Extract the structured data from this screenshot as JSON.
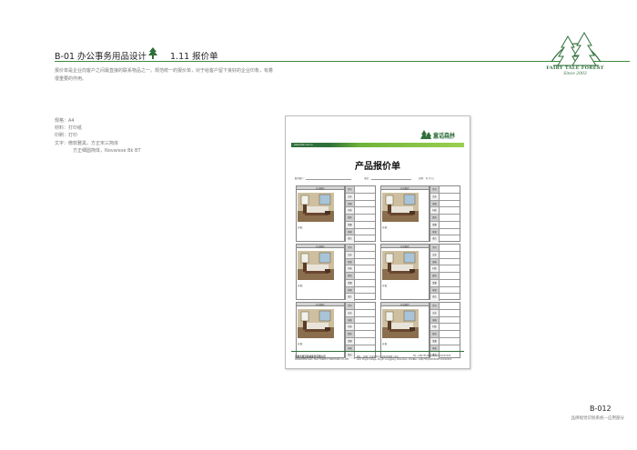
{
  "header": {
    "section_title": "B-01 办公事务用品设计",
    "item_title": "1.11  报价单",
    "intro": "报价单是企业向客户之间最直接的联系物品之一。规范统一的报价单，对于给客户留下良好的企业印象，有着很重要的作用。"
  },
  "specs": {
    "size": "规格：A4",
    "material": "材料：打印纸",
    "print": "印刷：打印",
    "text1": "文字：微软雅黑，方正宋三简体",
    "text2": "方正细圆简体，Novarese Bk BT"
  },
  "brand": {
    "name": "FAIRY TALE FOREST",
    "since": "Since 2003",
    "color": "#2f6f3a"
  },
  "document": {
    "brand_cn": "童话森林",
    "brand_en": "FAIRY TALE FOREST",
    "url": "www.dhsl.com.cn",
    "title": "产品报价单",
    "client_label": "联系客户：",
    "phone_label": "电话：",
    "date_label": "日期：     年    月    日",
    "card_head": "产品图片",
    "price_label": "价格：",
    "fields": [
      "型号",
      "品名",
      "规格",
      "材质",
      "颜色",
      "重量",
      "体积",
      "备注"
    ],
    "footer_company": "深圳市童话森林家具有限公司",
    "footer_company_en": "SHENZHEN FAIRY TALE FOREST FURNITURE CO.,LTD",
    "footer_address": "地址：中国广东省深圳市龙岗区坪地镇工业区",
    "footer_address_en": "Add: Pingdi Village, Pingdi, Longgang, Shenzhen, China",
    "footer_tel": "Tel: +86(755)XXXXXXXX  XXXXXXXX",
    "footer_fax": "Fax: +86(755)XXXXXXXX XXXXXXXX"
  },
  "page": {
    "number": "B-012",
    "subtitle": "品牌视觉识别系统—应用部分"
  }
}
